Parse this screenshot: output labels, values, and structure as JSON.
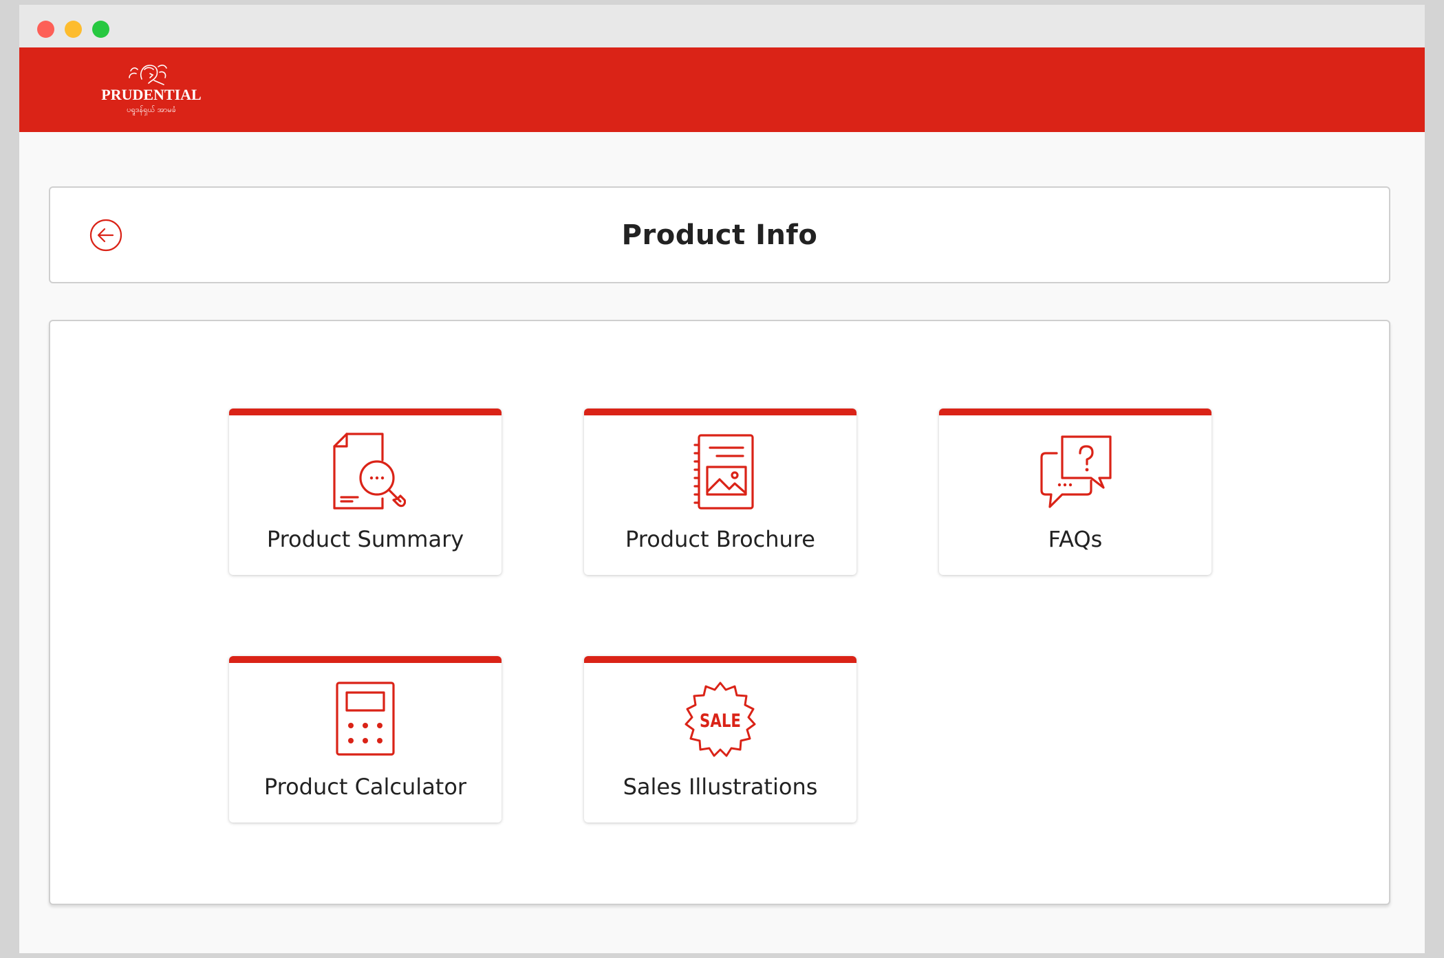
{
  "header": {
    "logo_text": "PRUDENTIAL",
    "logo_subtext": "ပရူဒန်ရှယ် အာမခံ",
    "brand_color": "#da2317"
  },
  "page": {
    "title": "Product Info",
    "back_icon": "back-arrow-circle-icon"
  },
  "tiles": [
    {
      "label": "Product Summary",
      "icon": "document-search-icon"
    },
    {
      "label": "Product Brochure",
      "icon": "brochure-icon"
    },
    {
      "label": "FAQs",
      "icon": "faq-chat-icon"
    },
    {
      "label": "Product Calculator",
      "icon": "calculator-icon"
    },
    {
      "label": "Sales Illustrations",
      "icon": "sale-badge-icon",
      "icon_text": "SALE"
    }
  ]
}
